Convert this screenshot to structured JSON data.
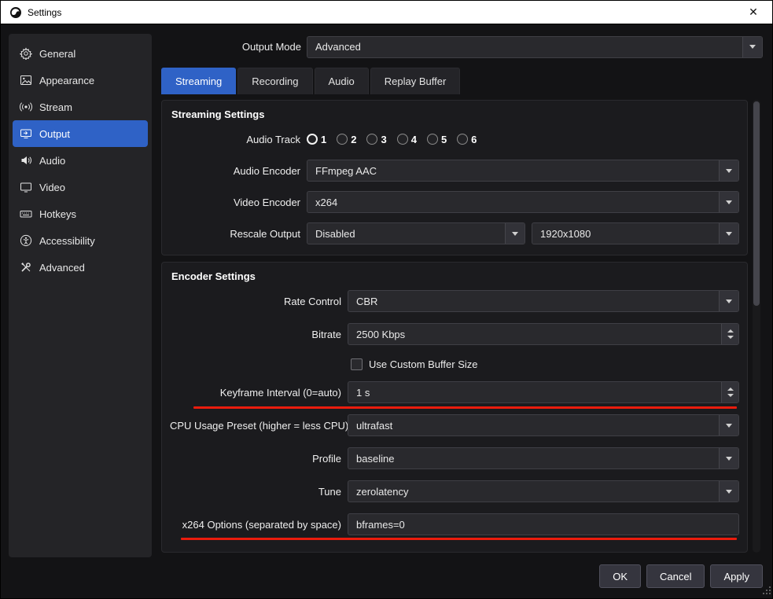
{
  "window": {
    "title": "Settings",
    "close_glyph": "✕"
  },
  "sidebar": {
    "items": [
      {
        "label": "General"
      },
      {
        "label": "Appearance"
      },
      {
        "label": "Stream"
      },
      {
        "label": "Output"
      },
      {
        "label": "Audio"
      },
      {
        "label": "Video"
      },
      {
        "label": "Hotkeys"
      },
      {
        "label": "Accessibility"
      },
      {
        "label": "Advanced"
      }
    ]
  },
  "output_mode": {
    "label": "Output Mode",
    "value": "Advanced"
  },
  "tabs": [
    {
      "label": "Streaming"
    },
    {
      "label": "Recording"
    },
    {
      "label": "Audio"
    },
    {
      "label": "Replay Buffer"
    }
  ],
  "streaming": {
    "title": "Streaming Settings",
    "audio_track_label": "Audio Track",
    "audio_tracks": [
      "1",
      "2",
      "3",
      "4",
      "5",
      "6"
    ],
    "selected_track": "1",
    "audio_encoder_label": "Audio Encoder",
    "audio_encoder_value": "FFmpeg AAC",
    "video_encoder_label": "Video Encoder",
    "video_encoder_value": "x264",
    "rescale_label": "Rescale Output",
    "rescale_value": "Disabled",
    "rescale_resolution": "1920x1080"
  },
  "encoder": {
    "title": "Encoder Settings",
    "rate_control_label": "Rate Control",
    "rate_control_value": "CBR",
    "bitrate_label": "Bitrate",
    "bitrate_value": "2500 Kbps",
    "buffer_checkbox_label": "Use Custom Buffer Size",
    "buffer_checkbox_checked": false,
    "keyframe_label": "Keyframe Interval (0=auto)",
    "keyframe_value": "1 s",
    "cpu_preset_label": "CPU Usage Preset (higher = less CPU)",
    "cpu_preset_value": "ultrafast",
    "profile_label": "Profile",
    "profile_value": "baseline",
    "tune_label": "Tune",
    "tune_value": "zerolatency",
    "x264_label": "x264 Options (separated by space)",
    "x264_value": "bframes=0"
  },
  "footer": {
    "ok": "OK",
    "cancel": "Cancel",
    "apply": "Apply"
  },
  "colors": {
    "accent": "#2f62c6",
    "annotation_red": "#ea1c0d",
    "titlebar": "#ffffff",
    "panel": "#1b1b1e"
  }
}
